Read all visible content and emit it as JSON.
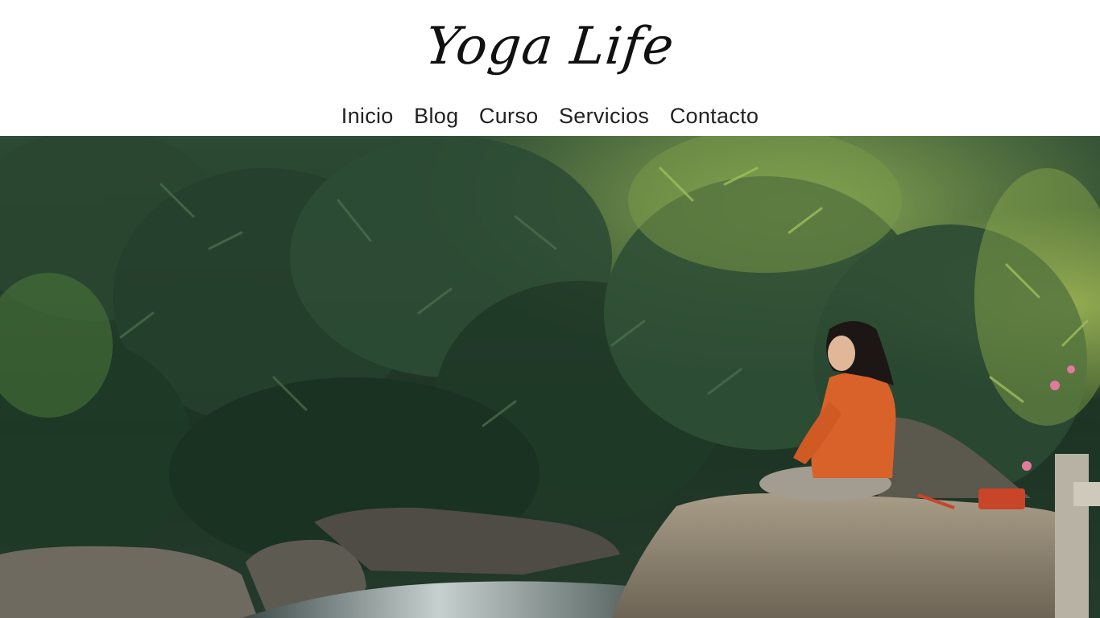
{
  "site": {
    "title": "Yoga Life"
  },
  "nav": {
    "items": [
      {
        "label": "Inicio"
      },
      {
        "label": "Blog"
      },
      {
        "label": "Curso"
      },
      {
        "label": "Servicios"
      },
      {
        "label": "Contacto"
      }
    ]
  },
  "hero": {
    "image": "photo of a woman in an orange sweater meditating on a rock beside a stream in a bamboo forest",
    "colors": {
      "foliage_dark": "#1e3526",
      "foliage_mid": "#2f5238",
      "foliage_light": "#7fa848",
      "rock": "#8a7f6e",
      "water": "#b9c4c4",
      "sweater": "#d9622b"
    }
  }
}
